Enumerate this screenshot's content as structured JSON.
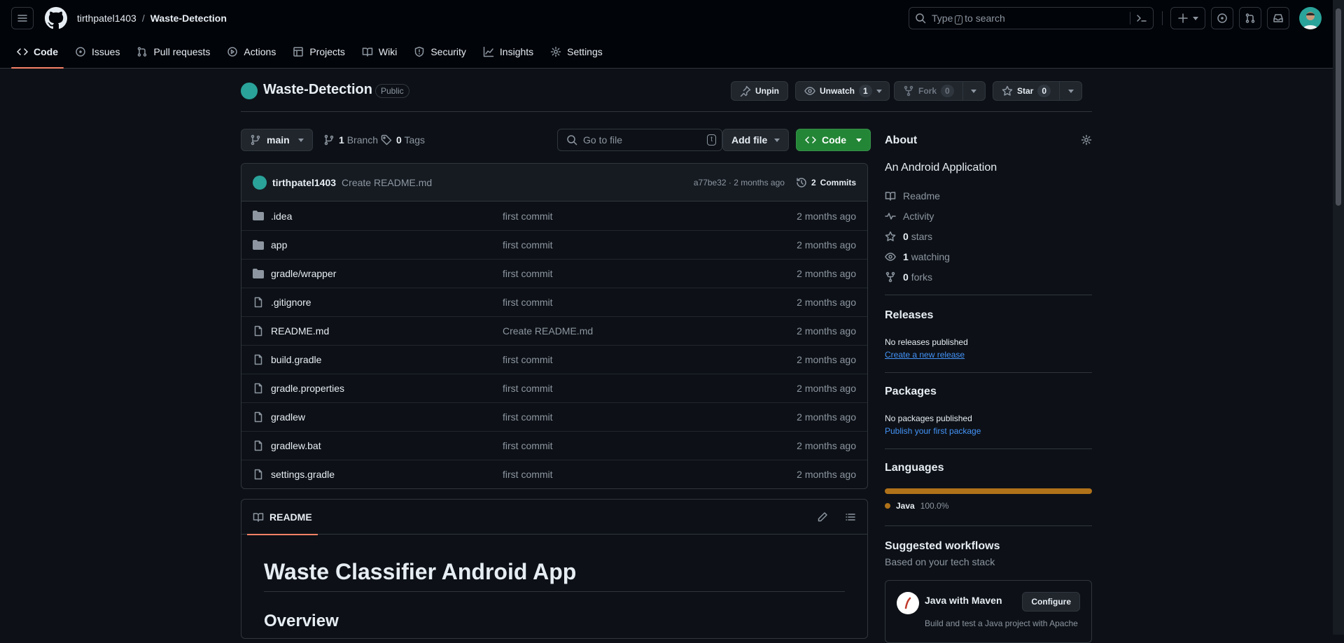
{
  "header": {
    "owner": "tirthpatel1403",
    "separator": "/",
    "repo": "Waste-Detection",
    "search_pre": "Type",
    "search_key": "/",
    "search_post": "to search"
  },
  "tabs": [
    {
      "label": "Code",
      "icon": "code-icon"
    },
    {
      "label": "Issues",
      "icon": "issue-icon"
    },
    {
      "label": "Pull requests",
      "icon": "pull-request-icon"
    },
    {
      "label": "Actions",
      "icon": "play-icon"
    },
    {
      "label": "Projects",
      "icon": "table-icon"
    },
    {
      "label": "Wiki",
      "icon": "book-icon"
    },
    {
      "label": "Security",
      "icon": "shield-icon"
    },
    {
      "label": "Insights",
      "icon": "graph-icon"
    },
    {
      "label": "Settings",
      "icon": "gear-icon"
    }
  ],
  "repo": {
    "name": "Waste-Detection",
    "visibility": "Public",
    "unpin": "Unpin",
    "unwatch": "Unwatch",
    "watch_count": "1",
    "fork": "Fork",
    "fork_count": "0",
    "star": "Star",
    "star_count": "0"
  },
  "toolbar": {
    "branch": "main",
    "branches_count": "1",
    "branches_label": "Branch",
    "tags_count": "0",
    "tags_label": "Tags",
    "goto_placeholder": "Go to file",
    "goto_key": "t",
    "add_file": "Add file",
    "code": "Code"
  },
  "latest_commit": {
    "user": "tirthpatel1403",
    "message": "Create README.md",
    "hash_time": "a77be32 · 2 months ago",
    "commits_count": "2",
    "commits_label": "Commits"
  },
  "files": [
    {
      "name": ".idea",
      "type": "folder",
      "message": "first commit",
      "time": "2 months ago"
    },
    {
      "name": "app",
      "type": "folder",
      "message": "first commit",
      "time": "2 months ago"
    },
    {
      "name": "gradle/wrapper",
      "type": "folder",
      "message": "first commit",
      "time": "2 months ago"
    },
    {
      "name": ".gitignore",
      "type": "file",
      "message": "first commit",
      "time": "2 months ago"
    },
    {
      "name": "README.md",
      "type": "file",
      "message": "Create README.md",
      "time": "2 months ago"
    },
    {
      "name": "build.gradle",
      "type": "file",
      "message": "first commit",
      "time": "2 months ago"
    },
    {
      "name": "gradle.properties",
      "type": "file",
      "message": "first commit",
      "time": "2 months ago"
    },
    {
      "name": "gradlew",
      "type": "file",
      "message": "first commit",
      "time": "2 months ago"
    },
    {
      "name": "gradlew.bat",
      "type": "file",
      "message": "first commit",
      "time": "2 months ago"
    },
    {
      "name": "settings.gradle",
      "type": "file",
      "message": "first commit",
      "time": "2 months ago"
    }
  ],
  "readme": {
    "tab": "README",
    "h1": "Waste Classifier Android App",
    "h2": "Overview"
  },
  "about": {
    "title": "About",
    "description": "An Android Application",
    "readme": "Readme",
    "activity": "Activity",
    "stars_count": "0",
    "stars_label": "stars",
    "watching_count": "1",
    "watching_label": "watching",
    "forks_count": "0",
    "forks_label": "forks"
  },
  "releases": {
    "title": "Releases",
    "empty": "No releases published",
    "link": "Create a new release"
  },
  "packages": {
    "title": "Packages",
    "empty": "No packages published",
    "link": "Publish your first package"
  },
  "languages": {
    "title": "Languages",
    "items": [
      {
        "name": "Java",
        "percent": "100.0%",
        "color": "#b07219"
      }
    ]
  },
  "workflows": {
    "title": "Suggested workflows",
    "subtitle": "Based on your tech stack",
    "item_name": "Java with Maven",
    "item_button": "Configure",
    "item_desc": "Build and test a Java project with Apache"
  },
  "colors": {
    "accent_tab": "#f78166",
    "primary_button": "#238636",
    "link": "#4493f8",
    "background": "#0d1117"
  }
}
